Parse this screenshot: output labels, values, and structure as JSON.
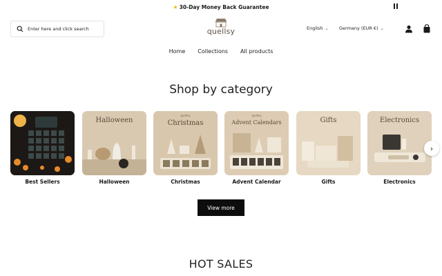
{
  "announcement": {
    "star_icon": "star-icon",
    "text": "30-Day Money Back Guarantee"
  },
  "header": {
    "search_placeholder": "Enter here and click search",
    "logo_text": "quellsy",
    "language": "English",
    "country": "Germany (EUR €)"
  },
  "nav": {
    "items": [
      "Home",
      "Collections",
      "All products"
    ]
  },
  "section": {
    "title": "Shop by category",
    "view_more": "View more"
  },
  "categories": [
    {
      "label": "Best Sellers",
      "tile_title": "",
      "tile_sub": ""
    },
    {
      "label": "Halloween",
      "tile_title": "Halloween",
      "tile_sub": ""
    },
    {
      "label": "Christmas",
      "tile_title": "Christmas",
      "tile_sub": "quellsy"
    },
    {
      "label": "Advent Calendar",
      "tile_title": "Advent Calendars",
      "tile_sub": "quellsy"
    },
    {
      "label": "Gifts",
      "tile_title": "Gifts",
      "tile_sub": ""
    },
    {
      "label": "Electronics",
      "tile_title": "Electronics",
      "tile_sub": ""
    }
  ],
  "hot_sales": {
    "title": "HOT SALES"
  },
  "colors": {
    "accent": "#0d0d0d",
    "star": "#f2b705"
  }
}
